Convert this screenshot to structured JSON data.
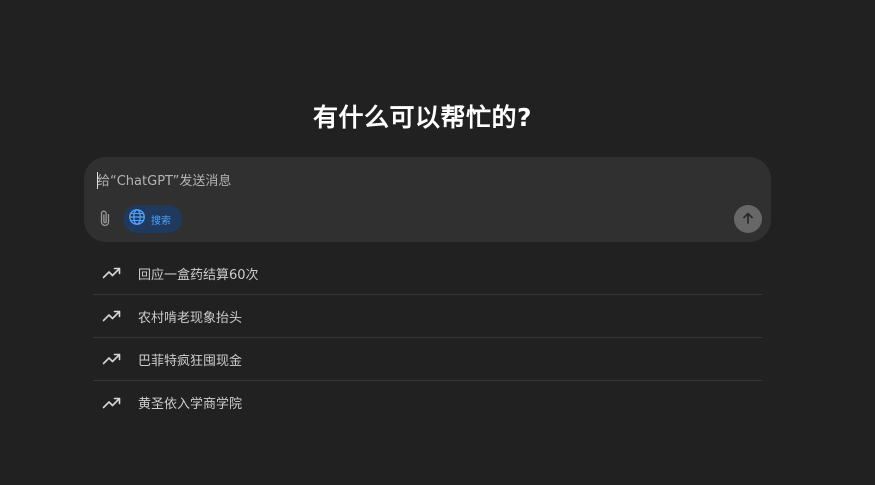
{
  "heading": "有什么可以帮忙的?",
  "composer": {
    "placeholder": "给“ChatGPT”发送消息",
    "attach_icon": "paperclip-icon",
    "search_label": "搜索",
    "search_icon": "globe-icon",
    "send_icon": "arrow-up-icon"
  },
  "suggestions": [
    {
      "label": "回应一盒药结算60次",
      "icon": "trending-up-icon"
    },
    {
      "label": "农村啃老现象抬头",
      "icon": "trending-up-icon"
    },
    {
      "label": "巴菲特疯狂囤现金",
      "icon": "trending-up-icon"
    },
    {
      "label": "黄圣依入学商学院",
      "icon": "trending-up-icon"
    }
  ],
  "colors": {
    "background": "#212121",
    "composer": "#303030",
    "search_accent": "#4ea1ff",
    "search_bg": "#1f3a5c",
    "send_button": "#676767"
  }
}
